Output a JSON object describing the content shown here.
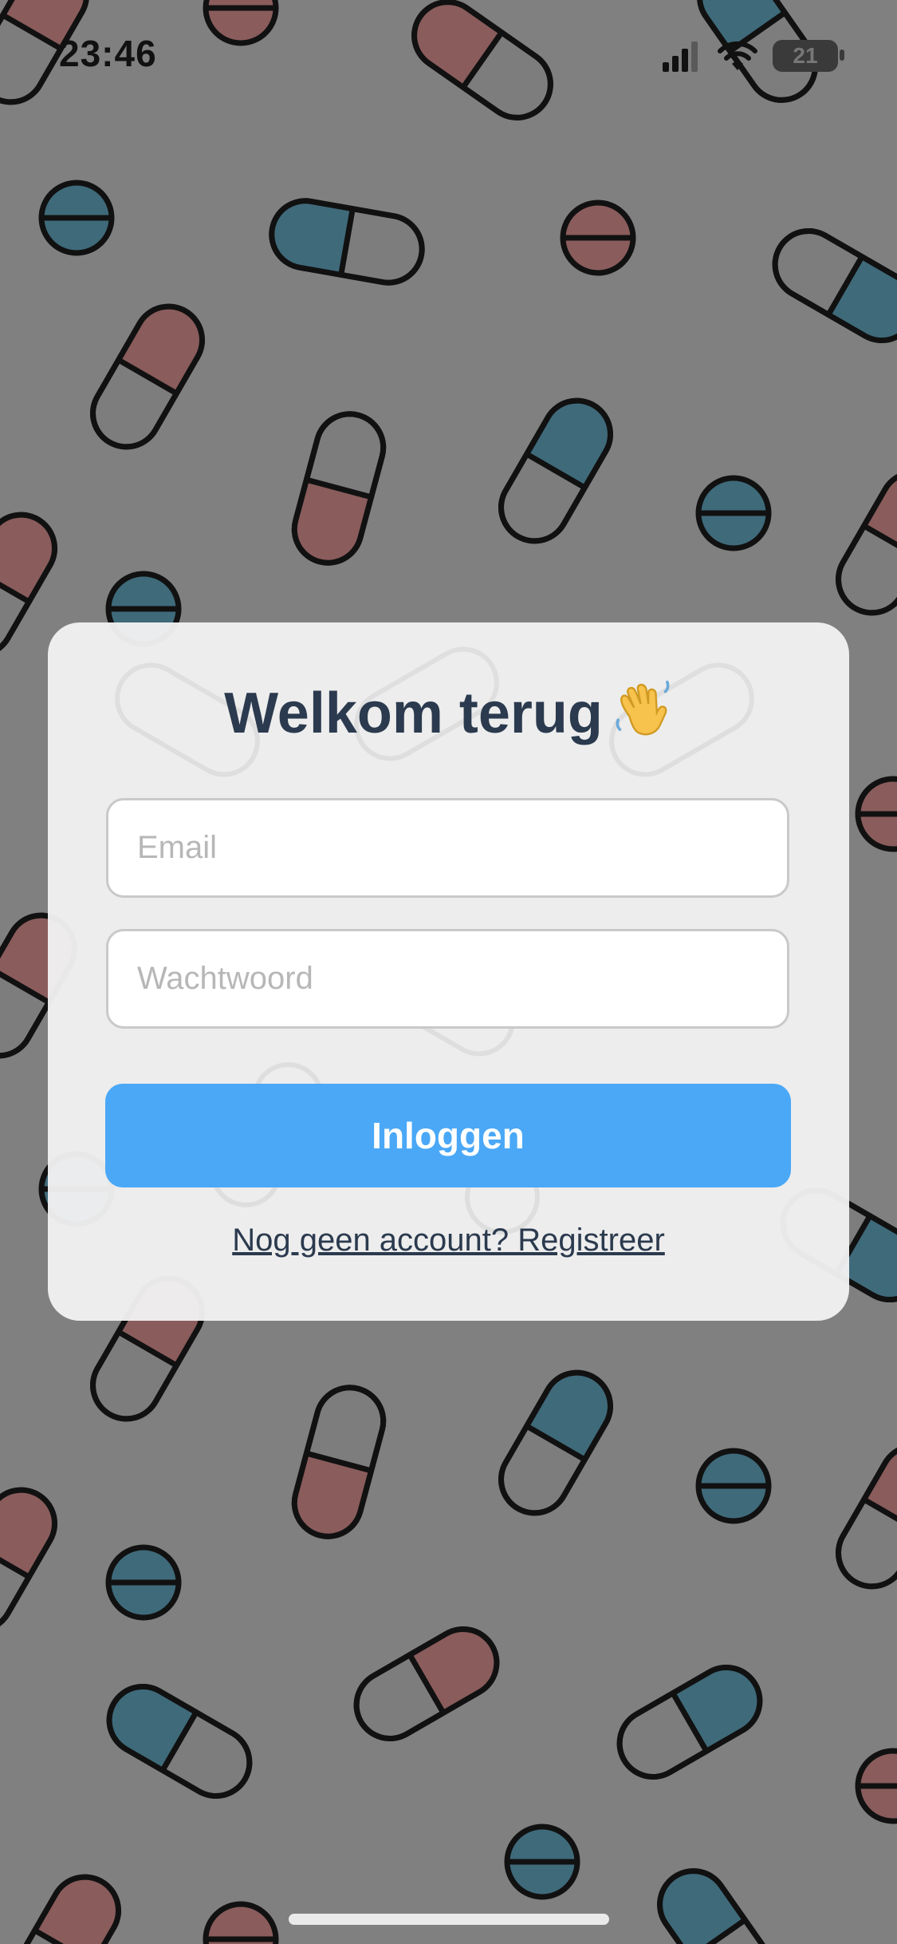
{
  "status_bar": {
    "time": "23:46",
    "battery": "21",
    "icons": [
      "signal-icon",
      "wifi-icon",
      "battery-icon"
    ]
  },
  "login": {
    "title": "Welkom terug",
    "title_icon": "waving-hand-icon",
    "email_placeholder": "Email",
    "password_placeholder": "Wachtwoord",
    "email_value": "",
    "password_value": "",
    "login_button": "Inloggen",
    "register_link": "Nog geen account? Registreer"
  },
  "background": {
    "pattern": "pills",
    "colors": {
      "base": "#808080",
      "pill_red": "#8a5c5c",
      "pill_blue": "#3f6a7a",
      "outline": "#111111"
    }
  },
  "colors": {
    "card": "#f1f1f1",
    "title": "#2b3a4e",
    "button": "#4aa8f7",
    "button_text": "#ffffff",
    "input_border": "#c9c9c9",
    "placeholder": "#b7b7b7"
  }
}
